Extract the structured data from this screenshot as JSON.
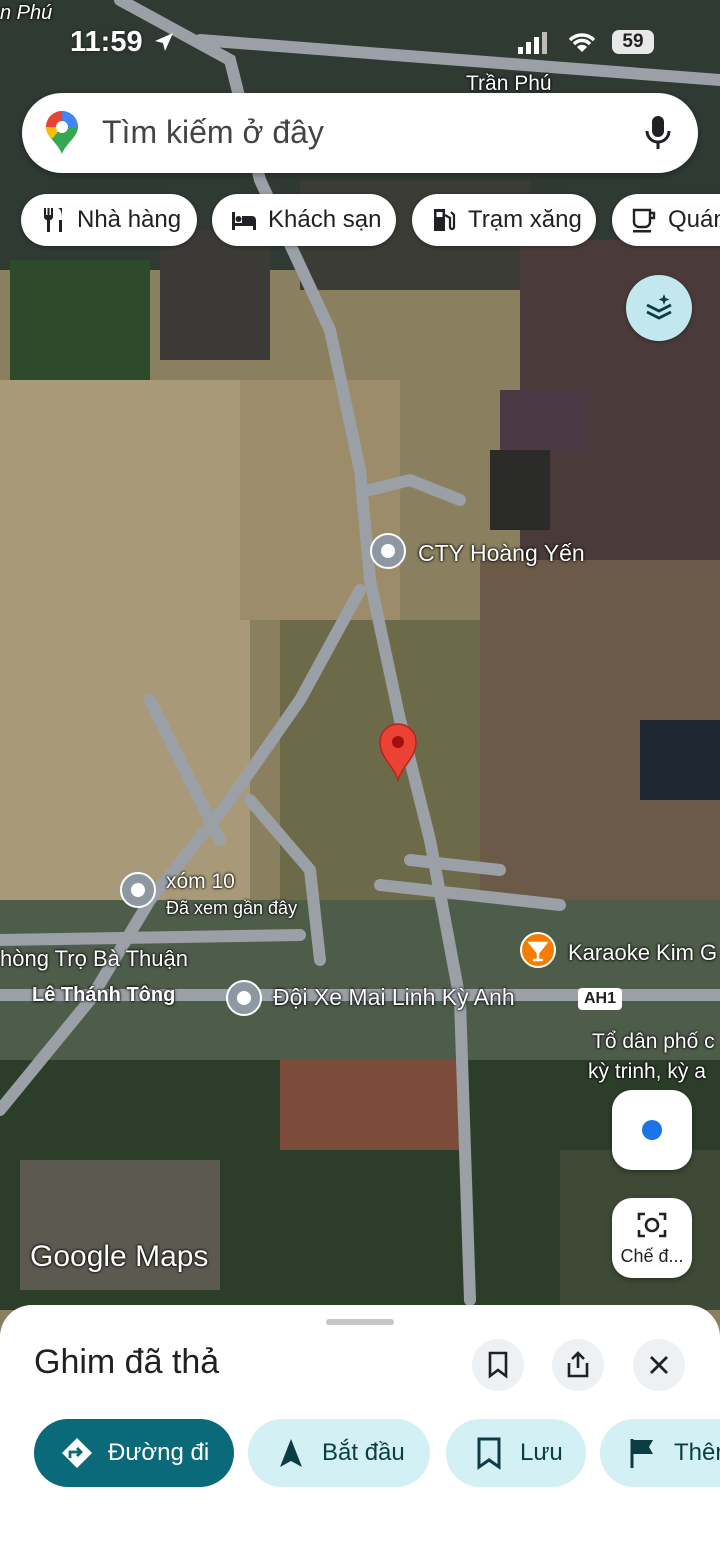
{
  "status_bar": {
    "time": "11:59",
    "battery": "59"
  },
  "search": {
    "placeholder": "Tìm kiếm ở đây"
  },
  "chips": [
    {
      "label": "Nhà hàng",
      "icon": "restaurant-icon"
    },
    {
      "label": "Khách sạn",
      "icon": "hotel-icon"
    },
    {
      "label": "Trạm xăng",
      "icon": "gas-station-icon"
    },
    {
      "label": "Quán",
      "icon": "cafe-icon"
    }
  ],
  "map": {
    "roads": {
      "top_left": "n Phú",
      "top_right": "Trần Phú",
      "le_thanh_tong": "Lê Thánh Tông",
      "ah1": "AH1"
    },
    "places": {
      "cty": "CTY Hoàng Yến",
      "xom10": "xóm 10",
      "xom10_sub": "Đã xem gần đây",
      "phong_tro": "hòng Trọ Bà Thuận",
      "doi_xe": "Đội Xe Mai Linh Kỳ Anh",
      "karaoke": "Karaoke Kim G",
      "to_dan_pho_1": "Tổ dân phố c",
      "to_dan_pho_2": "kỳ trinh, kỳ a"
    },
    "watermark": "Google Maps"
  },
  "camera_mode": {
    "label": "Chế đ..."
  },
  "sheet": {
    "title": "Ghim đã thả",
    "actions": [
      {
        "label": "Đường đi",
        "primary": true
      },
      {
        "label": "Bắt đầu",
        "primary": false
      },
      {
        "label": "Lưu",
        "primary": false
      },
      {
        "label": "Thêm",
        "primary": false
      }
    ]
  },
  "colors": {
    "primary": "#0b6a7a",
    "secondary_bg": "#d3f0f4",
    "pin": "#ea4335",
    "chip_text": "#202124"
  }
}
